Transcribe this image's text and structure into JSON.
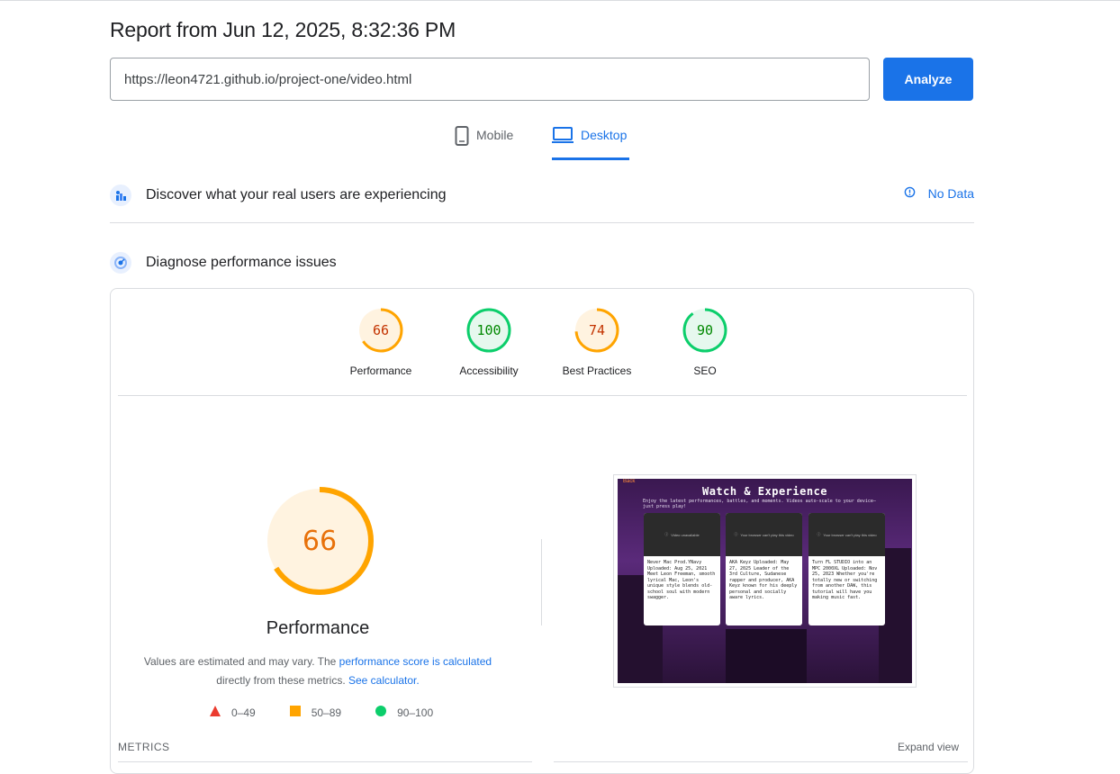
{
  "report": {
    "title": "Report from Jun 12, 2025, 8:32:36 PM"
  },
  "url_input": {
    "value": "https://leon4721.github.io/project-one/video.html"
  },
  "analyze_button": {
    "label": "Analyze"
  },
  "tabs": [
    {
      "label": "Mobile",
      "icon": "phone-icon",
      "selected": false
    },
    {
      "label": "Desktop",
      "icon": "laptop-icon",
      "selected": true
    }
  ],
  "field_section": {
    "heading": "Discover what your real users are experiencing",
    "status": "No Data",
    "icon": "users-chart-icon"
  },
  "lab_section": {
    "heading": "Diagnose performance issues",
    "icon": "speedometer-icon"
  },
  "scores": [
    {
      "label": "Performance",
      "value": "66",
      "level": "average"
    },
    {
      "label": "Accessibility",
      "value": "100",
      "level": "pass"
    },
    {
      "label": "Best Practices",
      "value": "74",
      "level": "average"
    },
    {
      "label": "SEO",
      "value": "90",
      "level": "pass"
    }
  ],
  "performance": {
    "score": "66",
    "title": "Performance",
    "note_prefix": "Values are estimated and may vary. The ",
    "note_link1": "performance score is calculated",
    "note_mid": "directly from these metrics. ",
    "note_link2": "See calculator."
  },
  "legend": [
    {
      "range": "0–49",
      "shape": "triangle",
      "color": "#eb3b2f"
    },
    {
      "range": "50–89",
      "shape": "square",
      "color": "#ffa400"
    },
    {
      "range": "90–100",
      "shape": "circle",
      "color": "#0cce6b"
    }
  ],
  "screenshot": {
    "back": "Back",
    "title": "Watch & Experience",
    "subtitle": "Enjoy the latest performances, battles, and moments. Videos auto-scale to your device—just press play!",
    "cards": [
      {
        "video_msg": "Video unavailable",
        "text": "Never Mac Prod.YNavy Uploaded: Aug 25, 2021 Meet Leon Freeman, smooth lyrical Mac, Leon's unique style blends old-school soul with modern swagger."
      },
      {
        "video_msg": "Your browser can't play this video",
        "text": "AKA Keyz Uploaded: May 27, 2025 Leader of the 3rd Culture, Sudanese rapper and producer, AKA Keyz known for his deeply personal and socially aware lyrics."
      },
      {
        "video_msg": "Your browser can't play this video",
        "text": "Turn FL STUDIO into an MPC 2000XL Uploaded: Nov 25, 2023 Whether you're totally new or switching from another DAW, this tutorial will have you making music fast."
      }
    ]
  },
  "metrics": {
    "label": "METRICS",
    "expand": "Expand view"
  },
  "colors": {
    "accent": "#1a73e8",
    "average": "#ffa400",
    "pass": "#0cce6b",
    "average_text": "#c33300",
    "pass_text": "#008800"
  }
}
